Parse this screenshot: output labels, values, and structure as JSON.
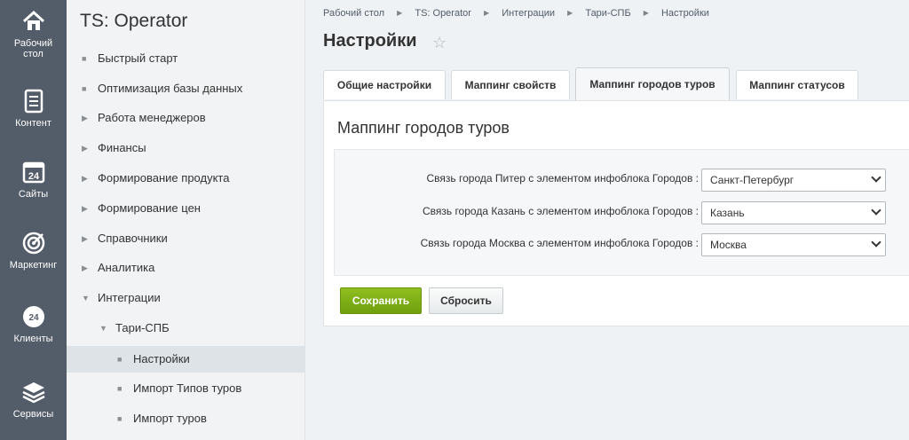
{
  "rail": {
    "items": [
      {
        "label_line1": "Рабочий",
        "label_line2": "стол",
        "icon": "home-icon"
      },
      {
        "label_line1": "Контент",
        "label_line2": "",
        "icon": "document-icon"
      },
      {
        "label_line1": "Сайты",
        "label_line2": "",
        "icon": "calendar-24-icon"
      },
      {
        "label_line1": "Маркетинг",
        "label_line2": "",
        "icon": "target-icon"
      },
      {
        "label_line1": "Клиенты",
        "label_line2": "",
        "icon": "clients-24-icon"
      },
      {
        "label_line1": "Сервисы",
        "label_line2": "",
        "icon": "layers-icon"
      }
    ],
    "icon_glyph_24": "24"
  },
  "menu": {
    "title": "TS: Operator",
    "items": [
      {
        "label": "Быстрый старт",
        "marker": "■"
      },
      {
        "label": "Оптимизация базы данных",
        "marker": "■"
      },
      {
        "label": "Работа менеджеров",
        "marker": "▶"
      },
      {
        "label": "Финансы",
        "marker": "▶"
      },
      {
        "label": "Формирование продукта",
        "marker": "▶"
      },
      {
        "label": "Формирование цен",
        "marker": "▶"
      },
      {
        "label": "Справочники",
        "marker": "▶"
      },
      {
        "label": "Аналитика",
        "marker": "▶"
      },
      {
        "label": "Интеграции",
        "marker": "▼"
      },
      {
        "label": "Тари-СПБ",
        "marker": "▼"
      },
      {
        "label": "Настройки",
        "marker": "■"
      },
      {
        "label": "Импорт Типов туров",
        "marker": "■"
      },
      {
        "label": "Импорт туров",
        "marker": "■"
      }
    ]
  },
  "breadcrumb": [
    "Рабочий стол",
    "TS: Operator",
    "Интеграции",
    "Тари-СПБ",
    "Настройки"
  ],
  "breadcrumb_separator": "▶",
  "page": {
    "title": "Настройки",
    "star": "☆"
  },
  "tabs": [
    "Общие настройки",
    "Маппинг свойств",
    "Маппинг городов туров",
    "Маппинг статусов"
  ],
  "panel": {
    "title": "Маппинг городов туров",
    "rows": [
      {
        "label": "Связь города Питер с элементом инфоблока Городов :",
        "value": "Санкт-Петербург"
      },
      {
        "label": "Связь города Казань с элементом инфоблока Городов :",
        "value": "Казань"
      },
      {
        "label": "Связь города Москва с элементом инфоблока Городов :",
        "value": "Москва"
      }
    ],
    "save_label": "Сохранить",
    "reset_label": "Сбросить"
  },
  "colors": {
    "rail": "#535c69",
    "accent_green": "#7bab15",
    "menu_bg": "#f1f3f4"
  }
}
